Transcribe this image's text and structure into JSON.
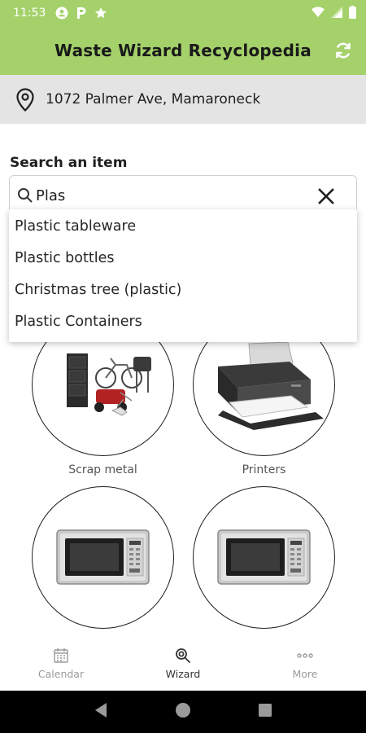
{
  "status_bar": {
    "time": "11:53",
    "icons_left": [
      "account-circle-icon",
      "parking-icon",
      "star-icon"
    ],
    "icons_right": [
      "wifi-icon",
      "cellular-icon",
      "battery-icon"
    ]
  },
  "app_bar": {
    "title": "Waste Wizard Recyclopedia",
    "action_icon": "refresh-icon",
    "color": "#a4d16a"
  },
  "location": {
    "icon": "location-pin-icon",
    "address": "1072 Palmer Ave, Mamaroneck"
  },
  "search": {
    "label": "Search an item",
    "value": "Plas",
    "suggestions": [
      "Plastic tableware",
      "Plastic bottles",
      "Christmas tree (plastic)",
      "Plastic Containers"
    ]
  },
  "items": [
    {
      "caption": "Scrap metal",
      "image": "scrap-metal-image"
    },
    {
      "caption": "Printers",
      "image": "printer-image"
    },
    {
      "caption": "",
      "image": "microwave-image"
    },
    {
      "caption": "",
      "image": "microwave-image"
    }
  ],
  "bottom_nav": [
    {
      "label": "Calendar",
      "icon": "calendar-icon",
      "active": false
    },
    {
      "label": "Wizard",
      "icon": "wizard-search-icon",
      "active": true
    },
    {
      "label": "More",
      "icon": "more-icon",
      "active": false
    }
  ],
  "system_nav": [
    "back-icon",
    "home-icon",
    "recents-icon"
  ]
}
